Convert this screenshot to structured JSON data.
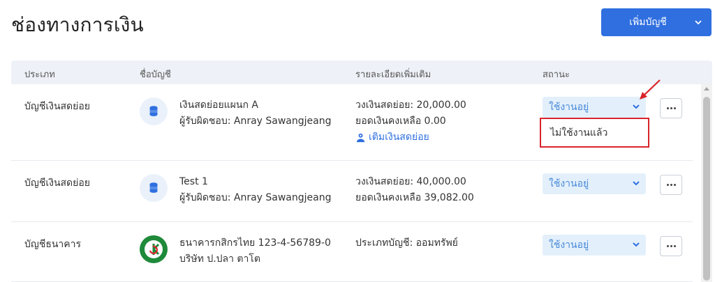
{
  "page": {
    "title": "ช่องทางการเงิน"
  },
  "header_button": {
    "label": "เพิ่มบัญชี",
    "icon": "chevron-down-icon",
    "color": "#2f6fe0"
  },
  "table": {
    "columns": [
      "ประเภท",
      "ชื่อบัญชี",
      "รายละเอียดเพิ่มเติม",
      "สถานะ"
    ],
    "rows": [
      {
        "type": "บัญชีเงินสดย่อย",
        "icon": "coin-stack-icon",
        "name": "เงินสดย่อยแผนก A",
        "subtitle": "ผู้รับผิดชอบ: Anray Sawangjeang",
        "details": [
          "วงเงินสดย่อย: 20,000.00",
          "ยอดเงินคงเหลือ 0.00"
        ],
        "link": "เติมเงินสดย่อย",
        "status": "ใช้งานอยู่"
      },
      {
        "type": "บัญชีเงินสดย่อย",
        "icon": "coin-stack-icon",
        "name": "Test 1",
        "subtitle": "ผู้รับผิดชอบ: Anray Sawangjeang",
        "details": [
          "วงเงินสดย่อย: 40,000.00",
          "ยอดเงินคงเหลือ 39,082.00"
        ],
        "status": "ใช้งานอยู่"
      },
      {
        "type": "บัญชีธนาคาร",
        "icon": "kasikorn-bank-logo",
        "name": "ธนาคารกสิกรไทย 123-4-56789-0",
        "subtitle": "บริษัท ป.ปลา ตาโต",
        "details": [
          "ประเภทบัญชี: ออมทรัพย์"
        ],
        "status": "ใช้งานอยู่"
      }
    ]
  },
  "status_dropdown": {
    "option": "ไม่ใช้งานแล้ว",
    "highlight_color": "#d9232a"
  }
}
